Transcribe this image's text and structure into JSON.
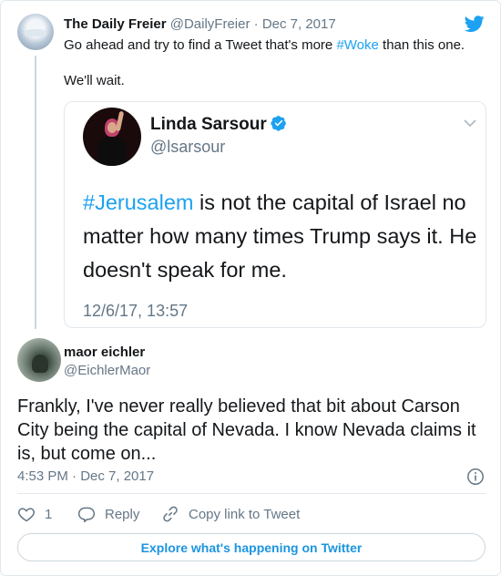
{
  "parent": {
    "name": "The Daily Freier",
    "handle": "@DailyFreier",
    "separator": "·",
    "date": "Dec 7, 2017",
    "text_before": "Go ahead and try to find a Tweet that's more ",
    "hashtag": "#Woke",
    "text_after": " than this one.",
    "text_line2": "We'll wait."
  },
  "quoted": {
    "name": "Linda Sarsour",
    "handle": "@lsarsour",
    "hashtag": "#Jerusalem",
    "text": " is not the capital of Israel no matter how many times Trump says it. He doesn't speak for me.",
    "date": "12/6/17, 13:57"
  },
  "reply": {
    "name": "maor eichler",
    "handle": "@EichlerMaor",
    "text": "Frankly, I've never really believed that bit about Carson City being the capital of Nevada. I know Nevada claims it is, but come on...",
    "time": "4:53 PM · Dec 7, 2017"
  },
  "actions": {
    "like_count": "1",
    "reply_label": "Reply",
    "copy_label": "Copy link to Tweet"
  },
  "explore_label": "Explore what's happening on Twitter",
  "colors": {
    "accent": "#1da1f2",
    "link": "#1b95e0",
    "secondary_text": "#657786",
    "border": "#e1e8ed"
  },
  "icons": {
    "brand": "twitter-bird-icon",
    "verified": "verified-badge-icon",
    "chevron": "chevron-down-icon",
    "info": "info-icon",
    "like": "heart-icon",
    "reply": "reply-bubble-icon",
    "copy": "link-icon"
  }
}
